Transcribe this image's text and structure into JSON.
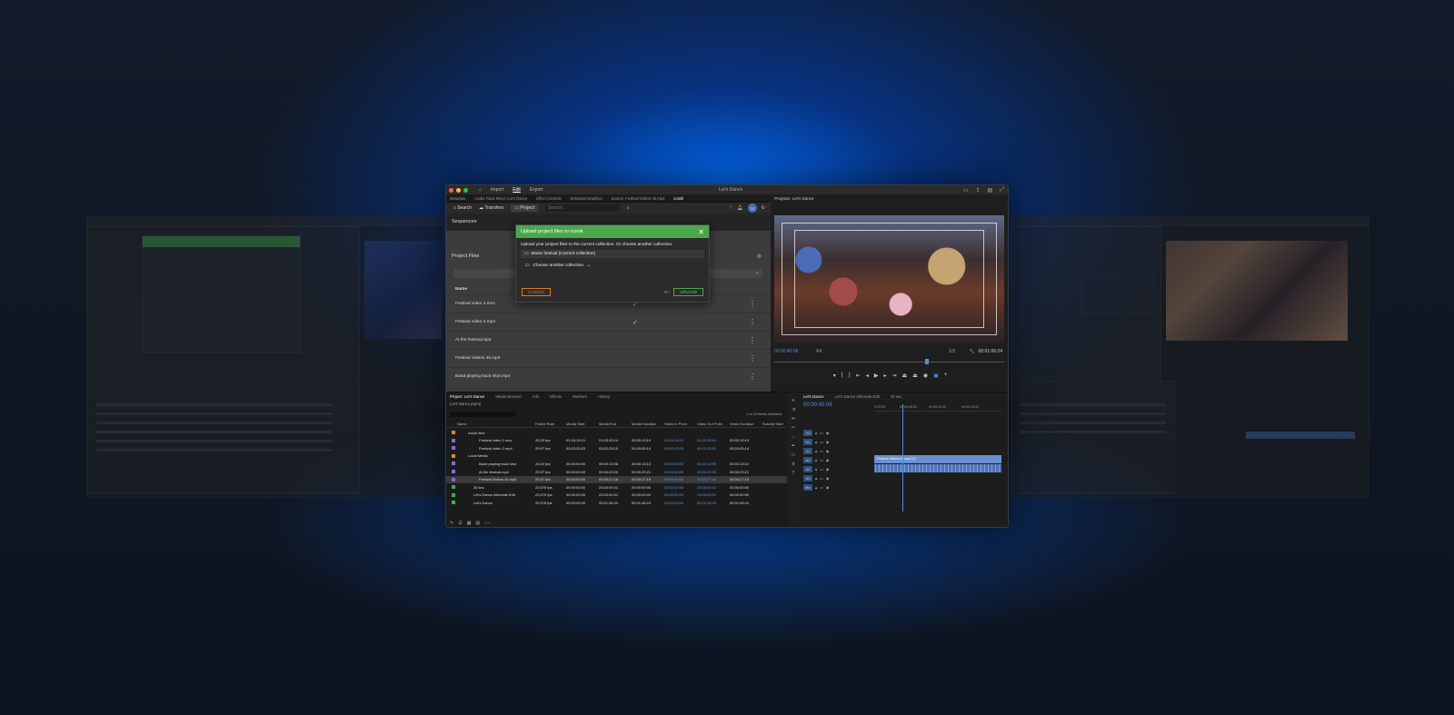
{
  "window": {
    "menu": [
      "Import",
      "Edit",
      "Export"
    ],
    "active_menu": "Edit",
    "title": "Let's Dance"
  },
  "panel_tabs": [
    "Metadata",
    "Audio Track Mixer: Let's Dance",
    "Effect Controls",
    "Essential Graphics",
    "Source: Festival Videos 4k.mp4",
    "iconik"
  ],
  "iconik": {
    "search_label": "Search",
    "transfers_label": "Transfers",
    "project_label": "Project",
    "search_placeholder": "Search...",
    "avatar_initials": "TC",
    "sequences_heading": "Sequences",
    "project_files_heading": "Project Files",
    "name_column": "Name",
    "files": [
      {
        "name": "Festival video 1.mov",
        "uploaded": true
      },
      {
        "name": "Festival video 2.mp4",
        "uploaded": true
      },
      {
        "name": "At the festival.mp4",
        "uploaded": false
      },
      {
        "name": "Festival Videos 4k.mp4",
        "uploaded": false
      },
      {
        "name": "Band playing back shot.mp4",
        "uploaded": false
      }
    ]
  },
  "modal": {
    "title": "Upload project files to iconik",
    "description": "Upload your project files to the current collection. Or choose another collection.",
    "current_collection": "Music festival (Current collection)",
    "choose_label": "Choose another collection",
    "cancel_label": "CANCEL",
    "upload_label": "UPLOAD",
    "shortcut": "⌘↵"
  },
  "program_monitor": {
    "title": "Program: Let's Dance",
    "timecode": "00:00:45:06",
    "fit": "Fit",
    "ratio": "1/2",
    "duration": "00:01:06:24"
  },
  "project_panel": {
    "tabs": [
      "Project: Let's Dance",
      "Media Browser",
      "Info",
      "Effects",
      "Markers",
      "History"
    ],
    "path": "Let's Dance.prproj",
    "item_count": "1 of 10 items selected",
    "columns": [
      "Name",
      "Frame Rate",
      "Media Start",
      "Media End",
      "Media Duration",
      "Video In Point",
      "Video Out Point",
      "Video Duration",
      "Subclip Start"
    ],
    "rows": [
      {
        "name": "iconik files",
        "indent": 0,
        "color": "#e08a2a",
        "fr": "",
        "ms": "",
        "me": "",
        "md": "",
        "vi": "",
        "vo": "",
        "vd": ""
      },
      {
        "name": "Festival video 1.mov",
        "indent": 2,
        "color": "#8a6ad0",
        "fr": "25,00 fps",
        "ms": "01:03:19:21",
        "me": "01:03:39:14",
        "md": "00:00:19:19",
        "vi": "01:03:19:21",
        "vo": "01:03:39:14",
        "vd": "00:00:19:19"
      },
      {
        "name": "Festival video 2.mp4",
        "indent": 2,
        "color": "#8a6ad0",
        "fr": "29,97 fps",
        "ms": "00;02;20;03",
        "me": "00;02;25;15",
        "md": "00;00;05;14",
        "vi": "00;02;20;03",
        "vo": "00;02;25;15",
        "vd": "00;00;05;14"
      },
      {
        "name": "Local Media",
        "indent": 0,
        "color": "#e08a2a",
        "fr": "",
        "ms": "",
        "me": "",
        "md": "",
        "vi": "",
        "vo": "",
        "vd": ""
      },
      {
        "name": "Band playing back shot",
        "indent": 2,
        "color": "#8a6ad0",
        "fr": "24,00 fps",
        "ms": "00:00:00:00",
        "me": "00:00:13:08",
        "md": "00:00:13:10",
        "vi": "00:00:00:00",
        "vo": "00:00:13:09",
        "vd": "00:00:13:10"
      },
      {
        "name": "At the festival.mp4",
        "indent": 2,
        "color": "#8a6ad0",
        "fr": "29,97 fps",
        "ms": "00;00;00;00",
        "me": "00;00;29;20",
        "md": "00;00;29;21",
        "vi": "00;00;00;00",
        "vo": "00;00;29;20",
        "vd": "00;00;29;21"
      },
      {
        "name": "Festival Videos 4k.mp4",
        "indent": 2,
        "color": "#8a6ad0",
        "fr": "29,97 fps",
        "ms": "00;00;00;00",
        "me": "00;00;27;18",
        "md": "00;00;27;19",
        "vi": "00;00;00;00",
        "vo": "00;00;27;18",
        "vd": "00;00;27;19",
        "selected": true
      },
      {
        "name": "30 sec",
        "indent": 1,
        "color": "#3fae5a",
        "fr": "23,976 fps",
        "ms": "00:00:00:00",
        "me": "23:00:00:01",
        "md": "00:00:00:00",
        "vi": "00:00:00:00",
        "vo": "23:00:00:01",
        "vd": "00:00:00:00"
      },
      {
        "name": "Let's Dance Alternate Edit",
        "indent": 1,
        "color": "#3fae5a",
        "fr": "23,976 fps",
        "ms": "00:00:00:00",
        "me": "23:00:00:01",
        "md": "00:00:00:00",
        "vi": "00:00:00:00",
        "vo": "23:00:00:01",
        "vd": "00:00:00:00"
      },
      {
        "name": "Let's Dance",
        "indent": 1,
        "color": "#3fae5a",
        "fr": "23,976 fps",
        "ms": "00:00:00:00",
        "me": "00:01:06:23",
        "md": "00:01:06:24",
        "vi": "00:00:00:00",
        "vo": "00:01:06:23",
        "vd": "00:01:06:24"
      }
    ]
  },
  "timeline": {
    "tabs": [
      "Let's Dance",
      "Let's Dance Alternate Edit",
      "30 sec"
    ],
    "timecode": "00:00:45:06",
    "ruler": [
      "0:00:00",
      "00:00:05:00",
      "00:00:10:00",
      "00:00:15:00"
    ],
    "tracks": [
      "V3",
      "V2",
      "V1",
      "A1",
      "A2",
      "A3",
      "Mix"
    ],
    "clip_label": "Festival Videos 4k.mp4 [V]"
  }
}
